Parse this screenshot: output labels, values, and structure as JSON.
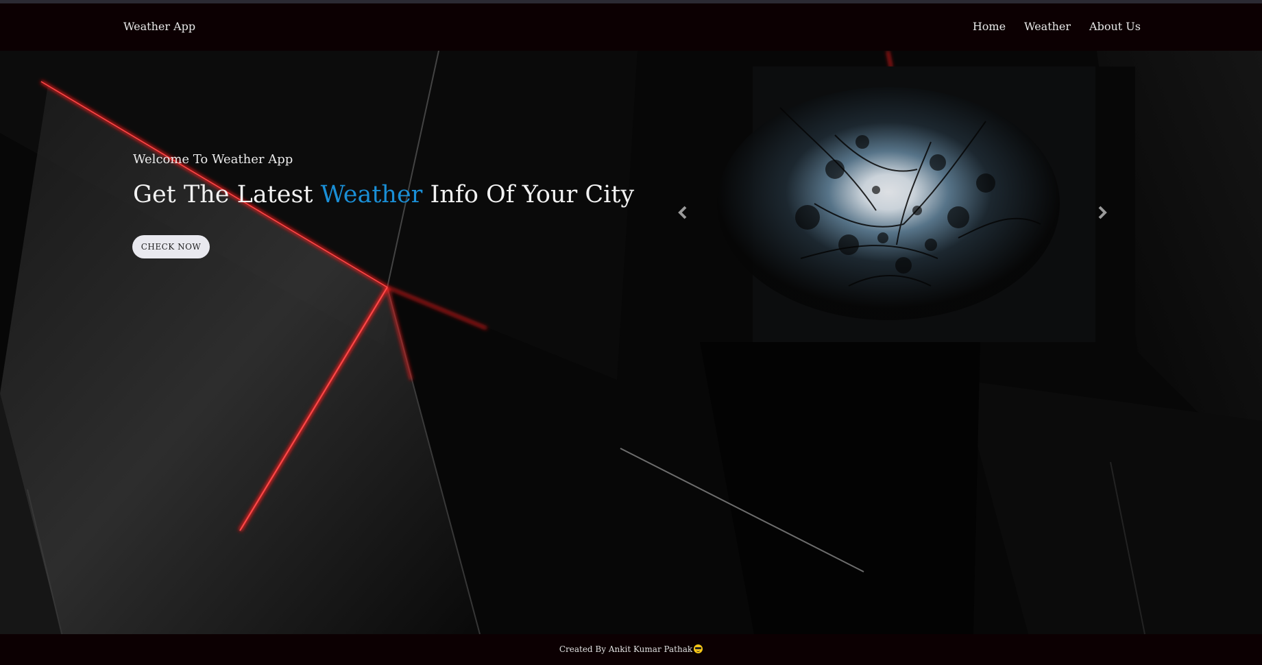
{
  "navbar": {
    "brand": "Weather App",
    "links": [
      {
        "label": "Home"
      },
      {
        "label": "Weather"
      },
      {
        "label": "About Us"
      }
    ]
  },
  "hero": {
    "welcome": "Welcome To Weather App",
    "headline_before": "Get The Latest ",
    "headline_accent": "Weather",
    "headline_after": " Info Of Your City",
    "button_label": "CHECK NOW"
  },
  "carousel": {
    "prev_icon": "chevron-left-icon",
    "next_icon": "chevron-right-icon",
    "image": "moon-through-trees-night-photo"
  },
  "footer": {
    "text": "Created By Ankit Kumar Pathak",
    "emoji": "sunglasses-face-emoji"
  },
  "colors": {
    "navbar_bg": "#0c0002",
    "accent": "#1a8fd6",
    "button_bg": "#e9e9ef"
  }
}
